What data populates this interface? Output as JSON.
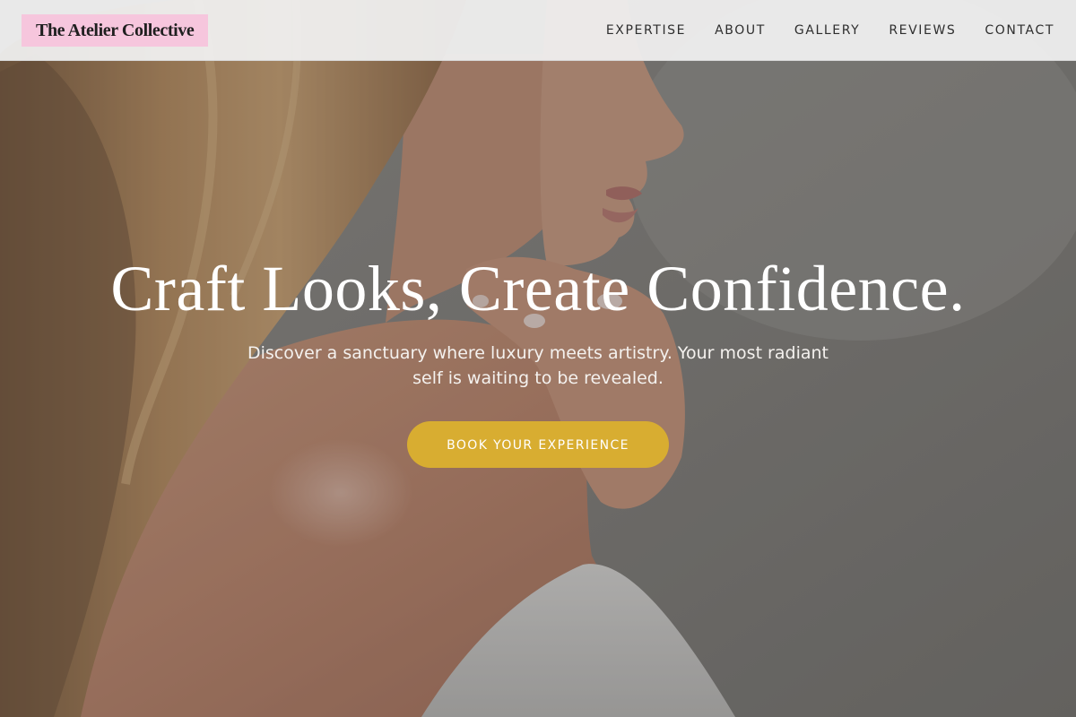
{
  "header": {
    "logo_text": "The Atelier Collective",
    "nav": [
      {
        "label": "EXPERTISE"
      },
      {
        "label": "ABOUT"
      },
      {
        "label": "GALLERY"
      },
      {
        "label": "REVIEWS"
      },
      {
        "label": "CONTACT"
      }
    ]
  },
  "hero": {
    "title": "Craft Looks, Create Confidence.",
    "subtitle": "Discover a sanctuary where luxury meets artistry. Your most radiant self is waiting to be revealed.",
    "cta_label": "BOOK YOUR EXPERIENCE"
  },
  "colors": {
    "logo_background": "#f6c6dd",
    "header_background": "#f0f0f0",
    "cta_background": "#d8ad31",
    "hero_text": "#ffffff"
  }
}
